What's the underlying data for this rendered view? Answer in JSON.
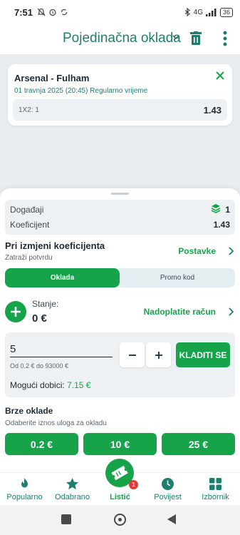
{
  "status_bar": {
    "time": "7:51",
    "battery": "36",
    "network": "4G"
  },
  "header": {
    "title": "Pojedinačna oklada"
  },
  "bet": {
    "match": "Arsenal - Fulham",
    "meta": "01 travnja 2025 (20:45) Regularno vrijeme",
    "pick": "1X2: 1",
    "odd": "1.43"
  },
  "summary": {
    "events_label": "Događaji",
    "events_value": "1",
    "odds_label": "Koeficijent",
    "odds_value": "1.43"
  },
  "odds_change": {
    "title": "Pri izmjeni koeficijenta",
    "subtitle": "Zatraži potvrdu",
    "settings_label": "Postavke"
  },
  "tabs": [
    {
      "label": "Oklada",
      "active": true
    },
    {
      "label": "Promo kod",
      "active": false
    }
  ],
  "balance": {
    "label": "Stanje:",
    "value": "0 €",
    "topup_label": "Nadoplatite račun"
  },
  "stake": {
    "value": "5",
    "range": "Od 0.2 € do 93000 €",
    "place_label": "KLADITI SE",
    "win_label": "Mogući dobici:",
    "win_value": "7.15 €"
  },
  "quick": {
    "title": "Brze oklade",
    "subtitle": "Odaberite iznos uloga za okladu",
    "amounts": [
      "0.2 €",
      "10 €",
      "25 €"
    ]
  },
  "nav": {
    "items": [
      {
        "label": "Popularno",
        "icon": "flame-icon"
      },
      {
        "label": "Odabrano",
        "icon": "star-icon"
      },
      {
        "label": "Listić",
        "icon": "ticket-icon",
        "badge": "1"
      },
      {
        "label": "Povijest",
        "icon": "clock-icon"
      },
      {
        "label": "Izbornik",
        "icon": "grid-icon"
      }
    ]
  },
  "colors": {
    "accent": "#16a34a",
    "title": "#1e7e6e",
    "badge": "#e53935"
  }
}
